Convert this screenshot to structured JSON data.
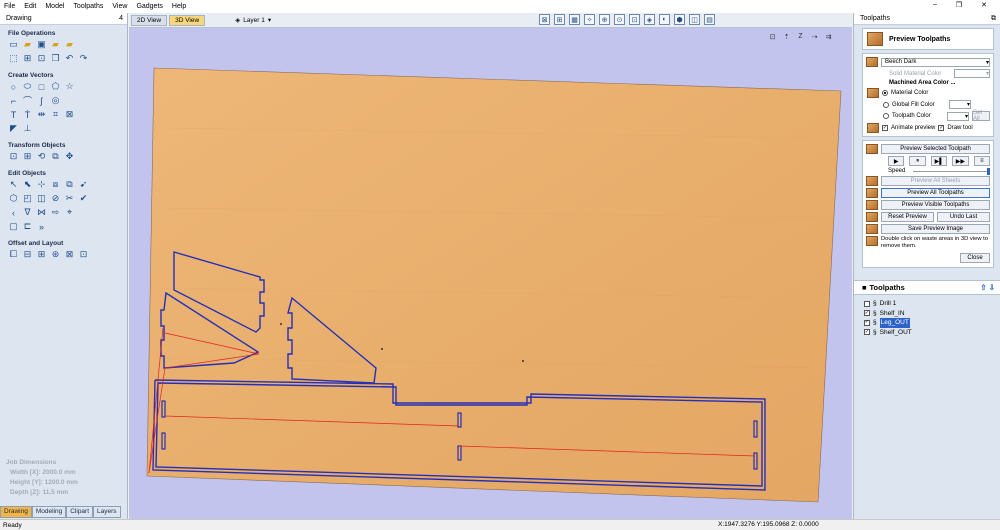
{
  "menu": [
    "File",
    "Edit",
    "Model",
    "Toolpaths",
    "View",
    "Gadgets",
    "Help"
  ],
  "left_panel": {
    "title": "Drawing",
    "pin": "4",
    "sections": [
      "File Operations",
      "Create Vectors",
      "Transform Objects",
      "Edit Objects",
      "Offset and Layout"
    ],
    "job_dimensions": {
      "title": "Job Dimensions",
      "width": "Width  [X]: 2000.0 mm",
      "height": "Height [Y]: 1200.0 mm",
      "depth": "Depth  [Z]: 11.5 mm"
    },
    "tabs": [
      "Drawing",
      "Modeling",
      "Clipart",
      "Layers"
    ]
  },
  "view": {
    "tabs": [
      "2D View",
      "3D View"
    ],
    "active_tab": "3D View",
    "layer": "Layer 1"
  },
  "right_panel": {
    "title": "Toolpaths",
    "preview": {
      "title": "Preview Toolpaths",
      "material": "Beech Dark",
      "solid_material_color": "Solid Material Color",
      "machined_area_title": "Machined Area Color ...",
      "options": [
        "Material Color",
        "Global Fill Color",
        "Toolpath Color"
      ],
      "set_all": "Set All",
      "animate_preview": "Animate preview",
      "draw_tool": "Draw tool",
      "preview_selected": "Preview Selected Toolpath",
      "speed": "Speed",
      "preview_all_sheets": "Preview All Sheets",
      "preview_all_toolpaths": "Preview All Toolpaths",
      "preview_visible_toolpaths": "Preview Visible Toolpaths",
      "reset_preview": "Reset Preview",
      "undo_last": "Undo Last",
      "save_preview_image": "Save Preview Image",
      "hint": "Double click on waste areas in 3D view to remove them.",
      "close": "Close"
    },
    "toolpaths": {
      "title": "Toolpaths",
      "items": [
        "Drill 1",
        "Shelf_IN",
        "Leg_OUT",
        "Shelf_OUT"
      ],
      "selected": "Leg_OUT"
    }
  },
  "status": {
    "left": "Ready",
    "coords": "X:1947.3276 Y:195.0968 Z: 0.0000"
  },
  "colors": {
    "wood": "#e8ae6c",
    "viewport_bg": "#c3c4ee",
    "toolpath_blue": "#2430b8",
    "toolpath_red": "#d22"
  }
}
